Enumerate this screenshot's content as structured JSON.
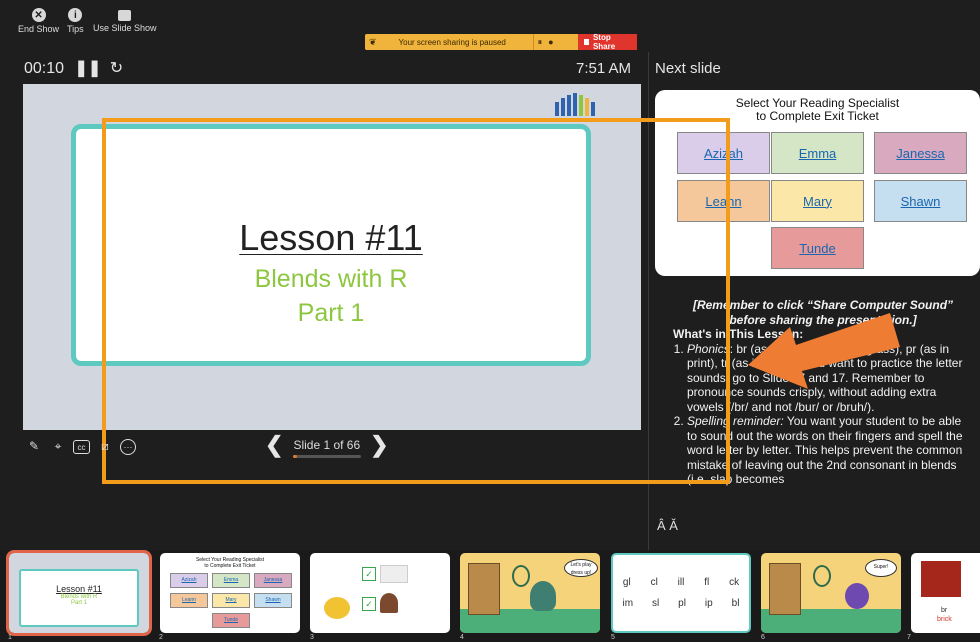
{
  "toolbar": {
    "end_show": "End Show",
    "tips": "Tips",
    "use_slide_show": "Use Slide Show"
  },
  "share_bar": {
    "message": "Your screen sharing is paused",
    "stop_label": "Stop Share"
  },
  "timer": "00:10",
  "clock": "7:51 AM",
  "next_slide_label": "Next slide",
  "current_slide": {
    "title": "Lesson #11",
    "subtitle_1": "Blends with R",
    "subtitle_2": "Part 1"
  },
  "slide_nav": {
    "counter": "Slide 1 of 66",
    "progress": 0.015
  },
  "next_slide_preview": {
    "title_line1": "Select Your Reading Specialist",
    "title_line2": "to Complete Exit Ticket",
    "tiles": [
      {
        "name": "Azizah",
        "color": "#d9cdea"
      },
      {
        "name": "Emma",
        "color": "#d4e6c6"
      },
      {
        "name": "Janessa",
        "color": "#d8a9bf"
      },
      {
        "name": "Leann",
        "color": "#f4c89a"
      },
      {
        "name": "Mary",
        "color": "#fbe8a8"
      },
      {
        "name": "Shawn",
        "color": "#c5dff0"
      },
      {
        "name": "Tunde",
        "color": "#e79a9a"
      }
    ]
  },
  "notes": {
    "line_reminder": "[Remember to click “Share Computer Sound” before sharing the presentation.]",
    "whats_in": "What's in This Lesson:",
    "item1_label": "Phonics",
    "item1_text": ": br (as in brick), gr (as in grass), pr (as in print), tr (as in tree). If you want to practice the letter sounds, go to Slides 7 and 17. Remember to pronounce sounds crisply, without adding extra vowels (/br/ and not /bur/ or /bruh/).",
    "item2_label": "Spelling reminder:",
    "item2_text": " You want your student to be able to sound out the words on their fingers and spell the word letter by letter. This helps prevent the common mistake of leaving out the 2nd consonant in blends (i.e. slap becomes"
  },
  "font_controls": "Â Ǎ",
  "thumbnails": [
    {
      "num": "1",
      "title": "Lesson #11",
      "sub1": "Blends with R",
      "sub2": "Part 1"
    },
    {
      "num": "2",
      "title1": "Select Your Reading Specialist",
      "title2": "to Complete Exit Ticket",
      "names": [
        "Azizah",
        "Emma",
        "Janessa",
        "Leann",
        "Mary",
        "Shawn",
        "Tunde"
      ]
    },
    {
      "num": "3"
    },
    {
      "num": "4",
      "bubble": "Let's play dress up!"
    },
    {
      "num": "5",
      "row1": [
        "gl",
        "cl",
        "ill",
        "fl",
        "ck"
      ],
      "row2": [
        "im",
        "sl",
        "pl",
        "ip",
        "bl"
      ]
    },
    {
      "num": "6",
      "bubble": "Super!"
    },
    {
      "num": "7",
      "word1": "br",
      "word2": "brick"
    }
  ],
  "colors": {
    "accent_teal": "#5ec9c0",
    "lesson_green": "#8dc63f",
    "overlay_orange": "#f39c1b",
    "arrow_orange": "#ee7d33"
  }
}
